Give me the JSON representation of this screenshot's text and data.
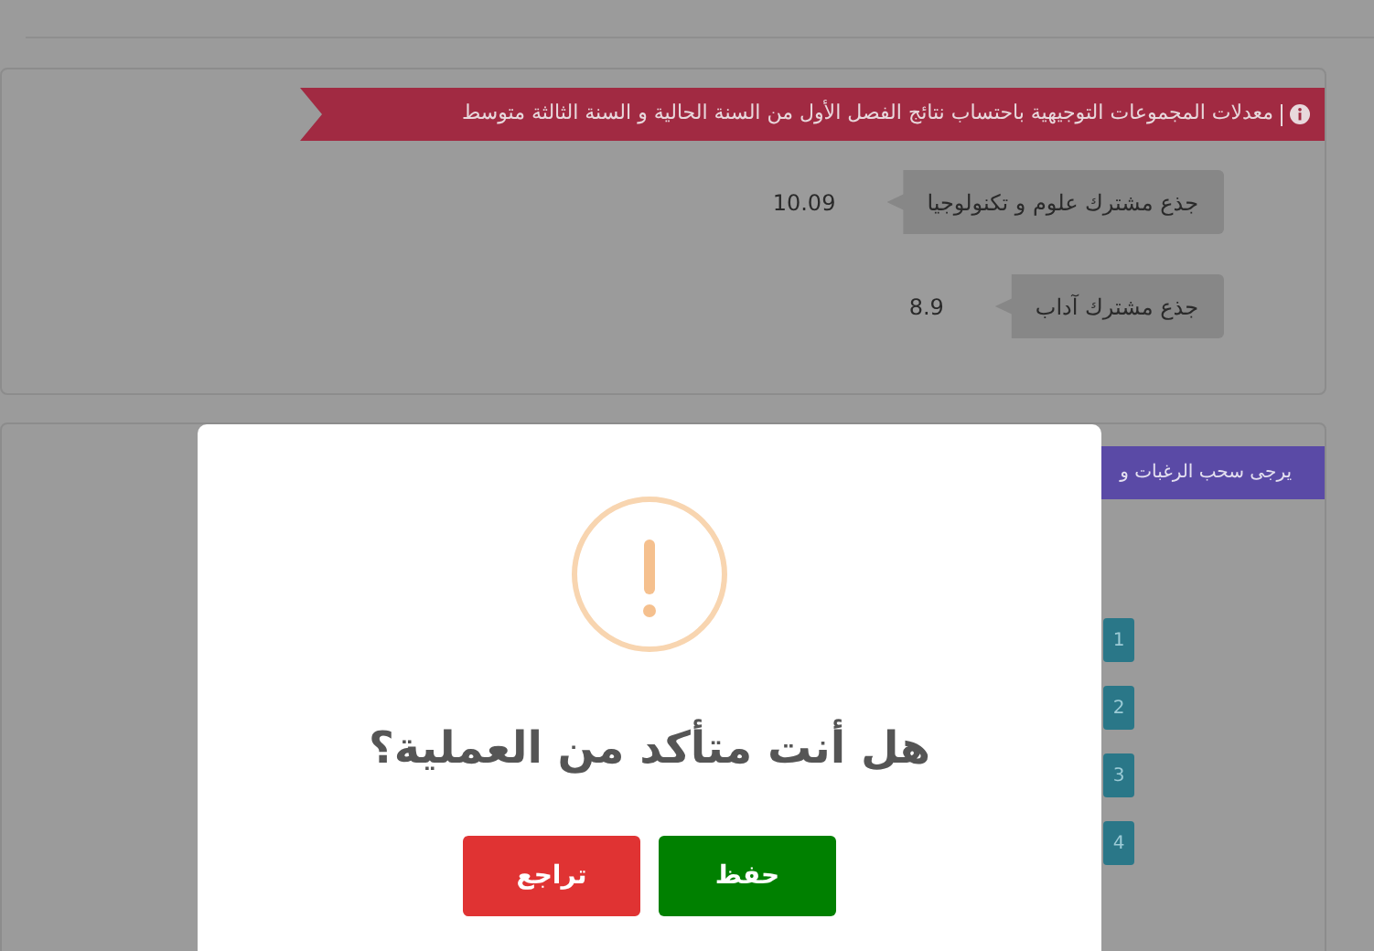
{
  "averages_panel": {
    "banner": "معدلات المجموعات التوجيهية باحتساب نتائج الفصل الأول من السنة الحالية و السنة الثالثة متوسط",
    "groups": [
      {
        "name": "جذع مشترك علوم و تكنولوجيا",
        "average": "10.09"
      },
      {
        "name": "جذع مشترك آداب",
        "average": "8.9"
      }
    ]
  },
  "choices_panel": {
    "banner": "يرجى سحب الرغبات و",
    "ranks": [
      "1",
      "2",
      "3",
      "4"
    ]
  },
  "dialog": {
    "title": "هل أنت متأكد من العملية؟",
    "buttons": [
      {
        "label": "حفظ",
        "kind": "confirm"
      },
      {
        "label": "تراجع",
        "kind": "cancel"
      }
    ]
  }
}
